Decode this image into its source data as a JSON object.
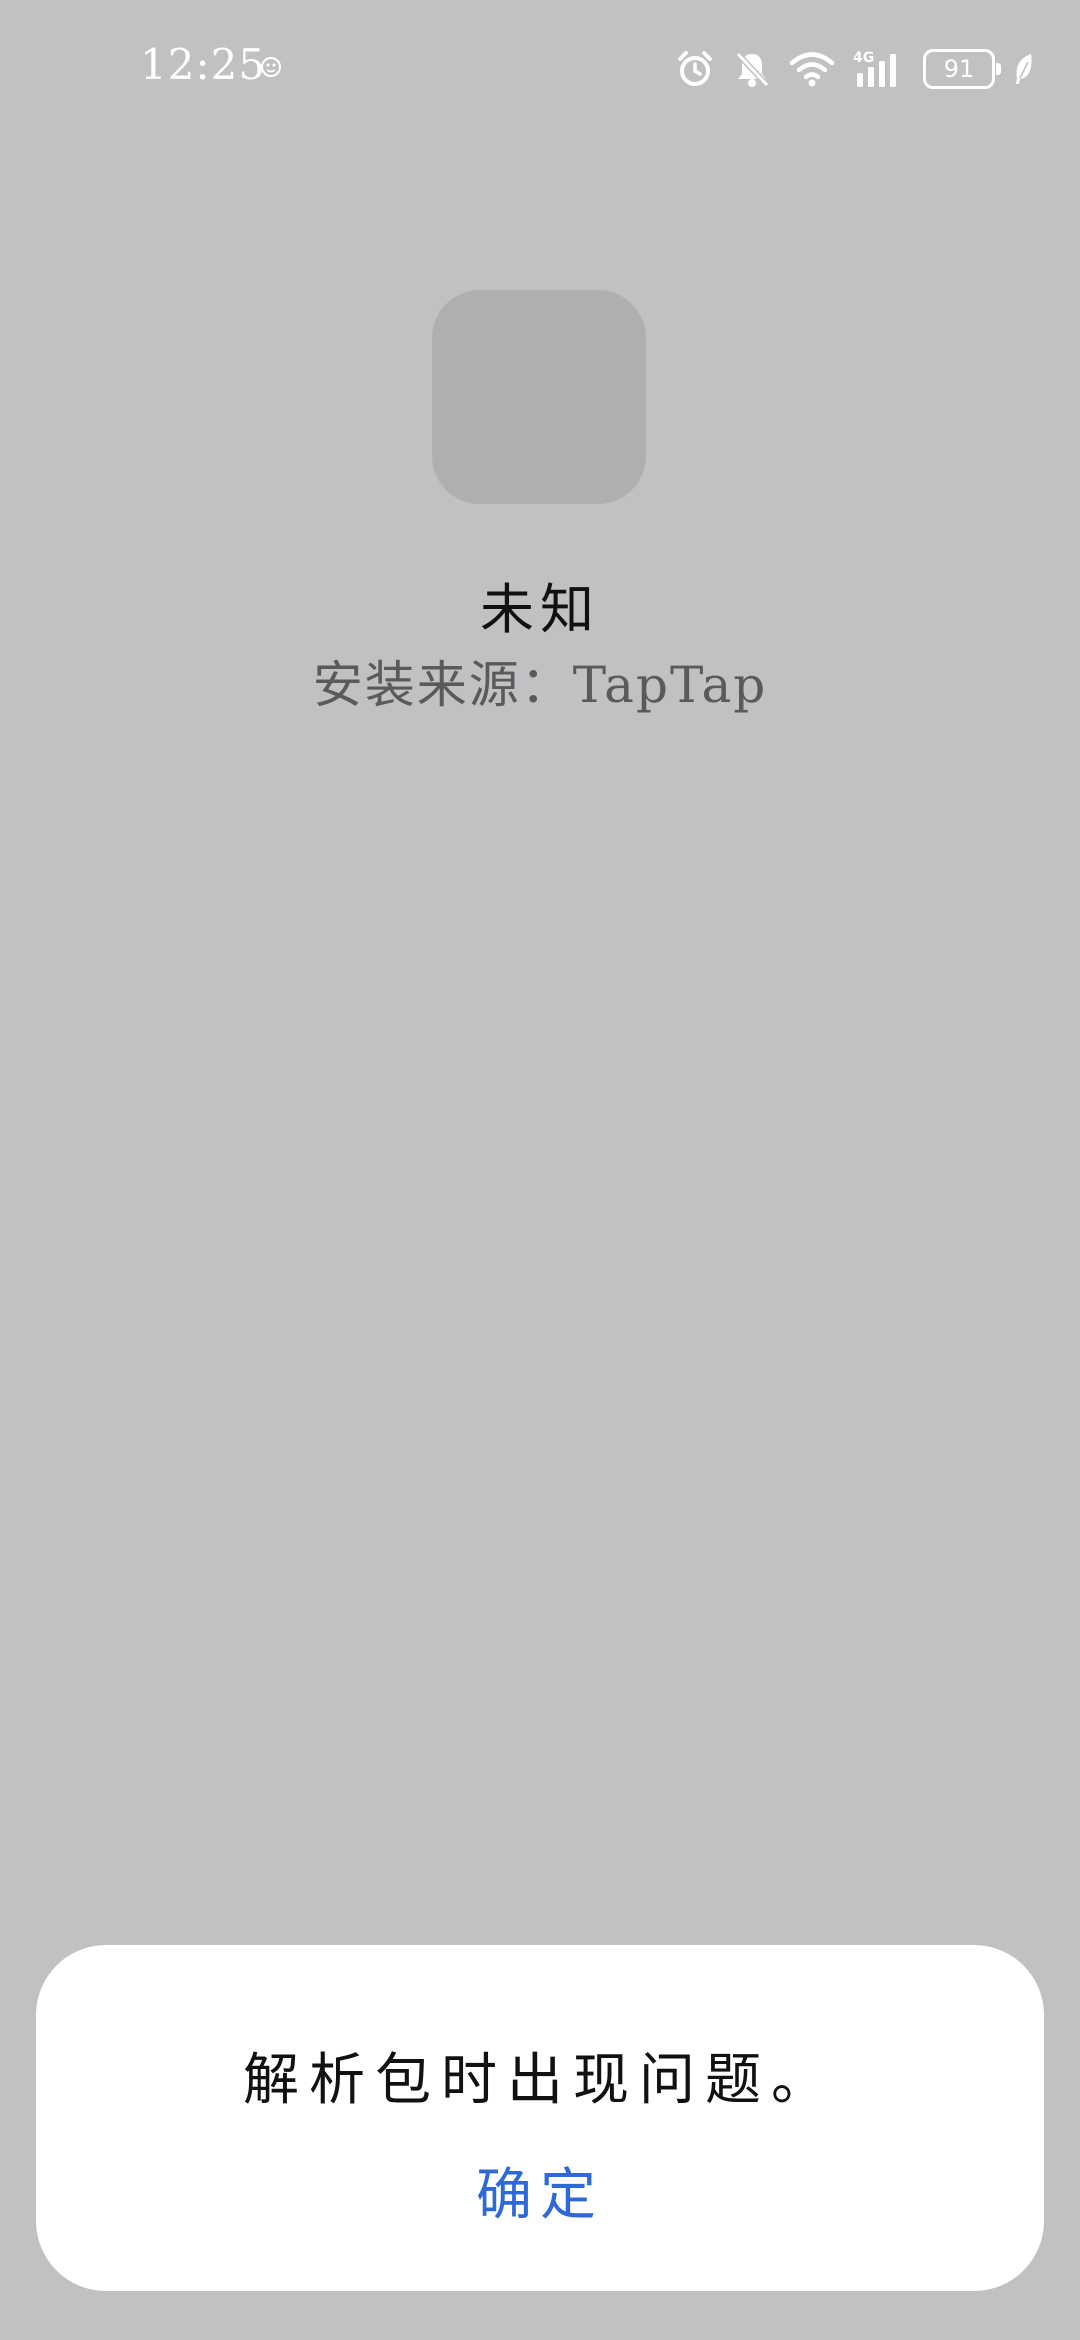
{
  "status_bar": {
    "time": "12:25",
    "battery_level": "91",
    "icons": [
      "face-emoji-icon",
      "alarm-icon",
      "bell-muted-icon",
      "wifi-icon",
      "4g-signal-icon",
      "battery-icon",
      "leaf-icon"
    ],
    "network_label": "4G"
  },
  "app": {
    "name": "未知",
    "install_source": "安装来源：TapTap"
  },
  "dialog": {
    "message": "解析包时出现问题。",
    "confirm_label": "确定"
  },
  "colors": {
    "background": "#c0c1c3",
    "icon_placeholder": "#aeafb1",
    "accent": "#2e69d8",
    "dialog_bg": "#ffffff"
  }
}
